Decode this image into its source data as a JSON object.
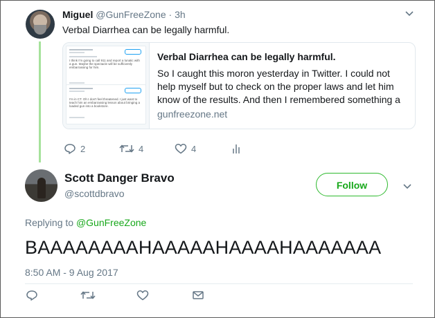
{
  "parent_tweet": {
    "author_name": "Miguel",
    "author_handle": "@GunFreeZone",
    "separator": "·",
    "time": "3h",
    "text": "Verbal Diarrhea can be legally harmful.",
    "card": {
      "title": "Verbal Diarrhea can be legally harmful.",
      "description": "So I caught this moron yesterday in Twitter.   I could not help myself but to check on the proper laws and let him know of the results. And then I remembered something a",
      "domain": "gunfreezone.net",
      "thumb_tweets": [
        {
          "name": "Scott Danger Bravo",
          "text": "I think I'm going to call 911 and report a lunatic with a gun. Maybe the spectacle will be sufficiently embarrassing for him."
        },
        {
          "name": "Scott Danger Bravo",
          "text": "I'm in CT. Oh I don't feel threatened. I just want to teach him an embarrassing lesson about bringing a loaded gun into a bookstore."
        }
      ]
    },
    "actions": {
      "replies": "2",
      "retweets": "4",
      "likes": "4"
    }
  },
  "main_tweet": {
    "author_name": "Scott Danger Bravo",
    "author_handle": "@scottdbravo",
    "follow_label": "Follow",
    "replying_prefix": "Replying to",
    "replying_handle": "@GunFreeZone",
    "text": "BAAAAAAAAHAAAAAHAAAAHAAAAAAA",
    "timestamp": "8:50 AM - 9 Aug 2017"
  },
  "icons": [
    "reply-icon",
    "retweet-icon",
    "like-icon",
    "analytics-icon",
    "message-icon",
    "chevron-down-icon"
  ],
  "colors": {
    "accent_green": "#17a81a",
    "thread_line": "#a6e29b",
    "muted_text": "#657786",
    "text": "#14171a"
  }
}
